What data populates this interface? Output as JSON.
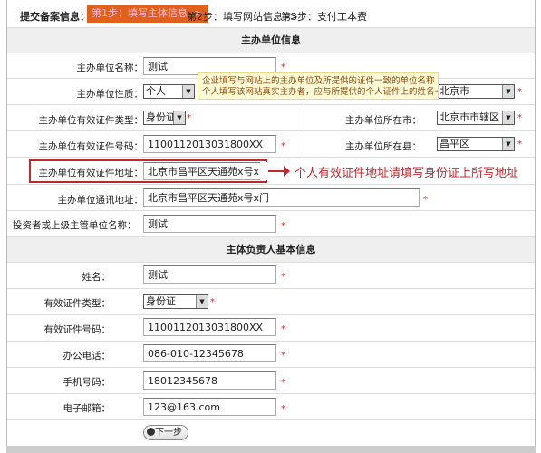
{
  "steps": {
    "title": "提交备案信息：",
    "step1": "第1步：填写主体信息 ->",
    "step2": "第2步：填写网站信息 ->",
    "step3": "第3步：支付工本费"
  },
  "section1": {
    "title": "主办单位信息",
    "name": {
      "label": "主办单位名称：",
      "value": "测试"
    },
    "nature": {
      "label": "主办单位性质：",
      "value": "个人"
    },
    "tooltip": {
      "line1": "企业填写与网站上的主办单位及所提供的证件一致的单位名称",
      "line2": "个人填写该网站真实主办者，应与所提供的个人证件上的姓名一致"
    },
    "province": {
      "value": "北京市"
    },
    "cert_type": {
      "label": "主办单位有效证件类型：",
      "value": "身份证"
    },
    "city": {
      "label": "主办单位所在市：",
      "value": "北京市市辖区"
    },
    "cert_no": {
      "label": "主办单位有效证件号码：",
      "value": "1100112013031800XX"
    },
    "county": {
      "label": "主办单位所在县：",
      "value": "昌平区"
    },
    "cert_addr": {
      "label": "主办单位有效证件地址：",
      "value": "北京市昌平区天通苑x号x门"
    },
    "annotation": "个人有效证件地址请填写身份证上所写地址",
    "mail_addr": {
      "label": "主办单位通讯地址：",
      "value": "北京市昌平区天通苑x号x门"
    },
    "investor": {
      "label": "投资者或上级主管单位名称：",
      "value": "测试"
    }
  },
  "section2": {
    "title": "主体负责人基本信息",
    "name": {
      "label": "姓名：",
      "value": "测试"
    },
    "cert_type": {
      "label": "有效证件类型：",
      "value": "身份证"
    },
    "cert_no": {
      "label": "有效证件号码：",
      "value": "1100112013031800XX"
    },
    "office_phone": {
      "label": "办公电话：",
      "value": "086-010-12345678"
    },
    "mobile": {
      "label": "手机号码：",
      "value": "18012345678"
    },
    "email": {
      "label": "电子邮箱：",
      "value": "123@163.com"
    }
  },
  "next_button": "下一步",
  "required_mark": "*",
  "colors": {
    "step_active": "#e0601c",
    "annotation": "#c0282d",
    "tooltip_bg": "#fffbd6"
  }
}
